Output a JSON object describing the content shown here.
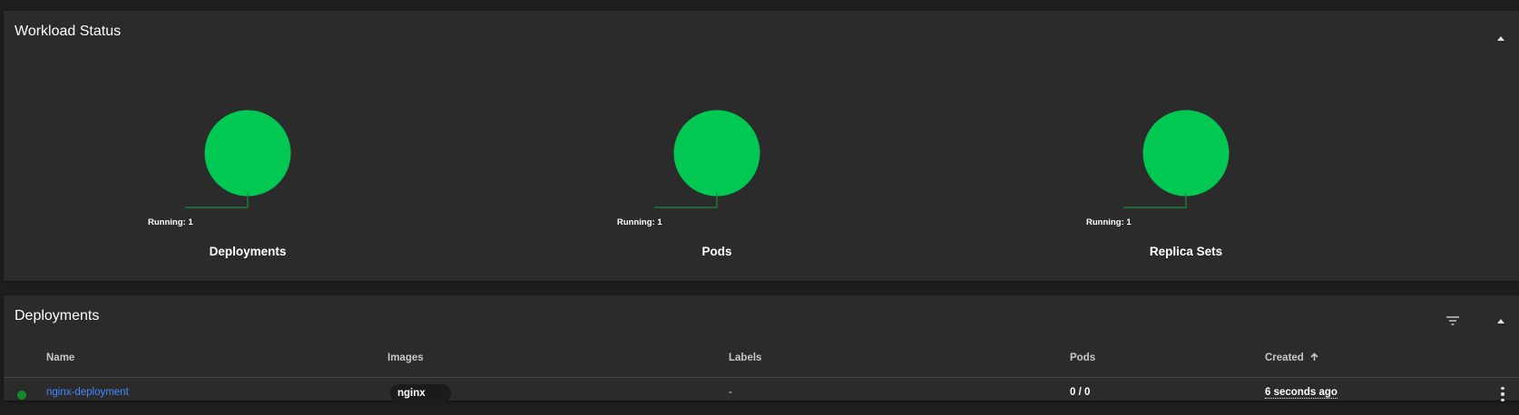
{
  "colors": {
    "running": "#00c853",
    "status_ok": "#128a2a",
    "link": "#448aff",
    "card_bg": "#2b2b2b",
    "page_bg": "#1e1e1e"
  },
  "workload_status": {
    "title": "Workload Status",
    "collapse_icon": "chevron-up-icon",
    "charts": [
      {
        "name": "Deployments",
        "label": "Running: 1",
        "segments": [
          {
            "status": "Running",
            "value": 1
          }
        ]
      },
      {
        "name": "Pods",
        "label": "Running: 1",
        "segments": [
          {
            "status": "Running",
            "value": 1
          }
        ]
      },
      {
        "name": "Replica Sets",
        "label": "Running: 1",
        "segments": [
          {
            "status": "Running",
            "value": 1
          }
        ]
      }
    ]
  },
  "deployments": {
    "title": "Deployments",
    "filter_icon": "filter-icon",
    "collapse_icon": "chevron-up-icon",
    "columns": {
      "name": "Name",
      "images": "Images",
      "labels": "Labels",
      "pods": "Pods",
      "created": "Created"
    },
    "sort_icon": "arrow-up-icon",
    "rows": [
      {
        "status": "running",
        "name": "nginx-deployment",
        "image": "nginx",
        "labels": "-",
        "pods": "0 / 0",
        "created": "6 seconds ago",
        "menu_icon": "more-vert-icon"
      }
    ]
  }
}
